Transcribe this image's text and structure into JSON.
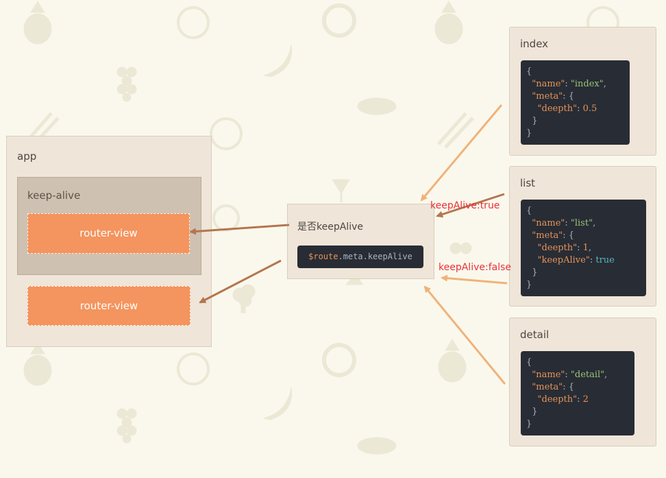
{
  "app": {
    "title": "app"
  },
  "keep_alive": {
    "title": "keep-alive"
  },
  "router_views": [
    "router-view",
    "router-view"
  ],
  "condition": {
    "title": "是否keepAlive",
    "code_var": "$route",
    "code_rest": ".meta.keepAlive"
  },
  "edge_labels": {
    "true_label": "keepAlive:true",
    "false_label": "keepAlive:false"
  },
  "routes": [
    {
      "title": "index",
      "lines": [
        "{",
        "  \"name\": \"index\",",
        "  \"meta\": {",
        "    \"deepth\": 0.5",
        "  }",
        "}"
      ]
    },
    {
      "title": "list",
      "lines": [
        "{",
        "  \"name\": \"list\",",
        "  \"meta\": {",
        "    \"deepth\": 1,",
        "    \"keepAlive\": true",
        "  }",
        "}"
      ]
    },
    {
      "title": "detail",
      "lines": [
        "{",
        "  \"name\": \"detail\",",
        "  \"meta\": {",
        "    \"deepth\": 2",
        "  }",
        "}"
      ]
    }
  ],
  "colors": {
    "background": "#faf8ec",
    "panel": "#efe5d8",
    "keep_alive": "#cfc1b1",
    "router_view": "#f4945e",
    "arrow_dark": "#b47550",
    "arrow_light": "#f0b27a",
    "edge_label": "#e8323a",
    "code_bg": "#282c34"
  },
  "background_icons": [
    "pineapple-icon",
    "watermelon-icon",
    "donut-icon",
    "banana-icon",
    "grapes-icon",
    "steak-icon",
    "asparagus-icon",
    "orange-slice-icon",
    "cocktail-icon",
    "cherry-icon",
    "broccoli-icon"
  ]
}
